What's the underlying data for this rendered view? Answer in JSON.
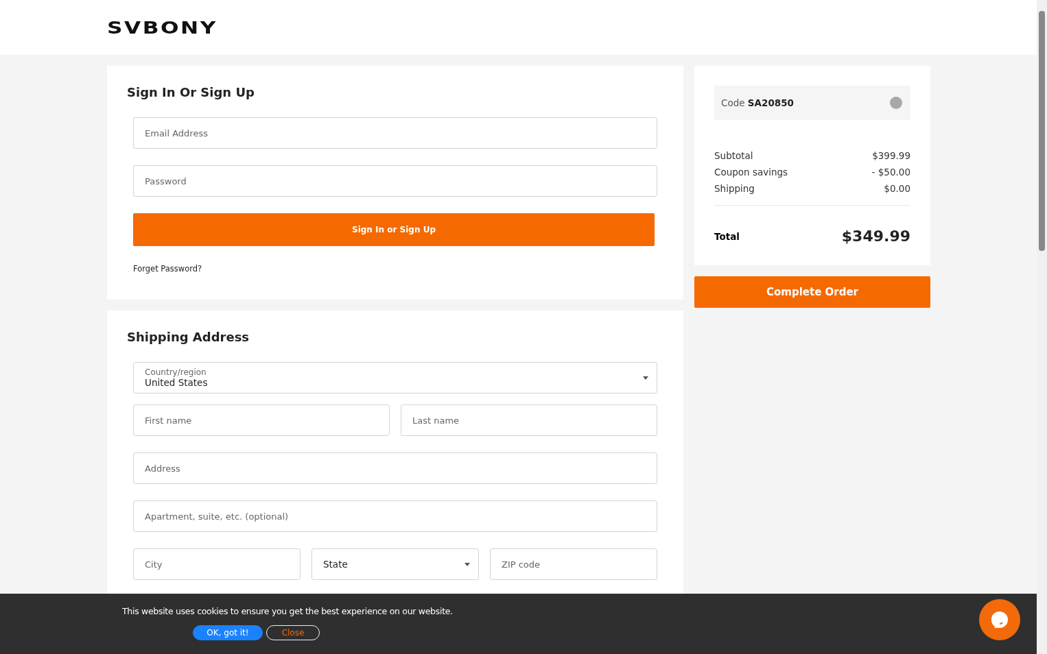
{
  "header": {
    "logo": "SVBONY"
  },
  "sign_in": {
    "title": "Sign In Or Sign Up",
    "email": {
      "placeholder": "Email Address"
    },
    "password": {
      "placeholder": "Password"
    },
    "submit": "Sign In or Sign Up",
    "forgot": "Forget Password?"
  },
  "shipping": {
    "title": "Shipping Address",
    "country": {
      "label": "Country/region",
      "value": "United States"
    },
    "first_name": {
      "placeholder": "First name"
    },
    "last_name": {
      "placeholder": "Last name"
    },
    "address": {
      "placeholder": "Address"
    },
    "apartment": {
      "placeholder": "Apartment, suite, etc. (optional)"
    },
    "city": {
      "placeholder": "City"
    },
    "state": {
      "value": "State"
    },
    "zip": {
      "placeholder": "ZIP code"
    }
  },
  "summary": {
    "code_label": "Code",
    "code": "SA20850",
    "lines": [
      {
        "label": "Subtotal",
        "value": "$399.99"
      },
      {
        "label": "Coupon savings",
        "value": "- $50.00"
      },
      {
        "label": "Shipping",
        "value": "$0.00"
      }
    ],
    "total_label": "Total",
    "total": "$349.99",
    "complete": "Complete Order"
  },
  "cookie_banner": {
    "message": "This website uses cookies to ensure you get the best experience on our website.",
    "accept": "OK, got it!",
    "close": "Close"
  }
}
